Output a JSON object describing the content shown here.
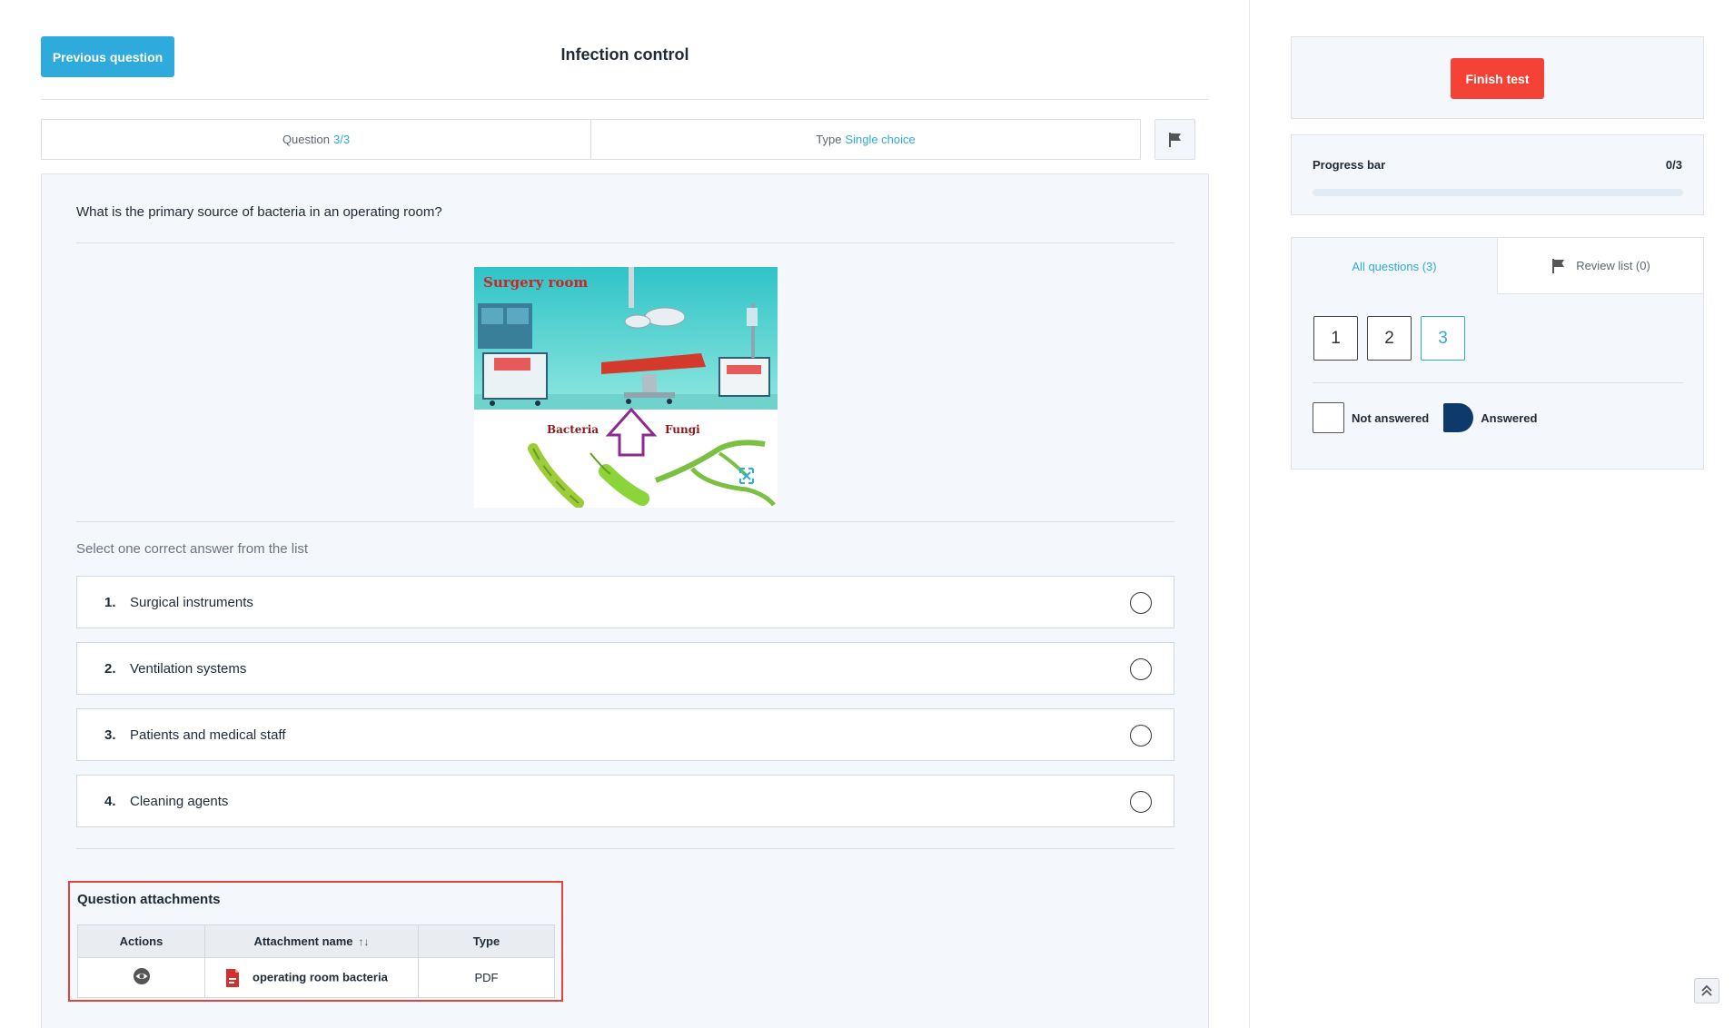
{
  "header": {
    "prev_label": "Previous question",
    "title": "Infection control"
  },
  "meta": {
    "question_label": "Question",
    "question_value": "3/3",
    "type_label": "Type",
    "type_value": "Single choice"
  },
  "question": {
    "text": "What is the primary source of bacteria in an operating room?",
    "image": {
      "room_caption": "Surgery room",
      "left_caption": "Bacteria",
      "right_caption": "Fungi"
    },
    "instruction": "Select one correct answer from the list",
    "options": [
      {
        "number": "1.",
        "label": "Surgical instruments"
      },
      {
        "number": "2.",
        "label": "Ventilation systems"
      },
      {
        "number": "3.",
        "label": "Patients and medical staff"
      },
      {
        "number": "4.",
        "label": "Cleaning agents"
      }
    ]
  },
  "attachments": {
    "title": "Question attachments",
    "columns": [
      "Actions",
      "Attachment name",
      "Type"
    ],
    "sort_glyph": "↑↓",
    "rows": [
      {
        "name": "operating room bacteria",
        "type": "PDF",
        "action_icon": "eye-icon",
        "file_icon": "pdf-file-icon"
      }
    ]
  },
  "sidebar": {
    "finish_label": "Finish test",
    "progress_label": "Progress bar",
    "progress_count": "0/3",
    "progress_fraction": 0,
    "tab_all": "All questions (3)",
    "tab_review": "Review list (0)",
    "numbers": [
      "1",
      "2",
      "3"
    ],
    "current_number": "3",
    "legend_not_answered": "Not answered",
    "legend_answered": "Answered"
  },
  "colors": {
    "accent": "#2eaadc",
    "danger": "#f44336",
    "answered": "#0d3a6b"
  }
}
